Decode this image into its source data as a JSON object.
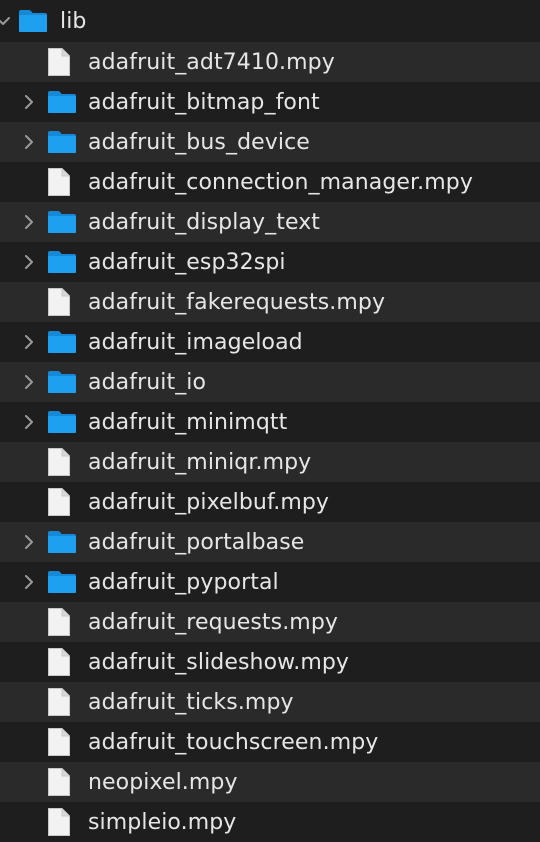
{
  "colors": {
    "row_even": "#1e1e1e",
    "row_odd": "#2a2a2a",
    "text": "#e6e6e6",
    "folder_blue": "#1ea0f0",
    "chevron": "#9a9a9a",
    "file_icon": "#f2f2f2"
  },
  "items": [
    {
      "name": "lib",
      "type": "folder",
      "expanded": true,
      "level": 0
    },
    {
      "name": "adafruit_adt7410.mpy",
      "type": "file",
      "level": 1
    },
    {
      "name": "adafruit_bitmap_font",
      "type": "folder",
      "expanded": false,
      "level": 1
    },
    {
      "name": "adafruit_bus_device",
      "type": "folder",
      "expanded": false,
      "level": 1
    },
    {
      "name": "adafruit_connection_manager.mpy",
      "type": "file",
      "level": 1
    },
    {
      "name": "adafruit_display_text",
      "type": "folder",
      "expanded": false,
      "level": 1
    },
    {
      "name": "adafruit_esp32spi",
      "type": "folder",
      "expanded": false,
      "level": 1
    },
    {
      "name": "adafruit_fakerequests.mpy",
      "type": "file",
      "level": 1
    },
    {
      "name": "adafruit_imageload",
      "type": "folder",
      "expanded": false,
      "level": 1
    },
    {
      "name": "adafruit_io",
      "type": "folder",
      "expanded": false,
      "level": 1
    },
    {
      "name": "adafruit_minimqtt",
      "type": "folder",
      "expanded": false,
      "level": 1
    },
    {
      "name": "adafruit_miniqr.mpy",
      "type": "file",
      "level": 1
    },
    {
      "name": "adafruit_pixelbuf.mpy",
      "type": "file",
      "level": 1
    },
    {
      "name": "adafruit_portalbase",
      "type": "folder",
      "expanded": false,
      "level": 1
    },
    {
      "name": "adafruit_pyportal",
      "type": "folder",
      "expanded": false,
      "level": 1
    },
    {
      "name": "adafruit_requests.mpy",
      "type": "file",
      "level": 1
    },
    {
      "name": "adafruit_slideshow.mpy",
      "type": "file",
      "level": 1
    },
    {
      "name": "adafruit_ticks.mpy",
      "type": "file",
      "level": 1
    },
    {
      "name": "adafruit_touchscreen.mpy",
      "type": "file",
      "level": 1
    },
    {
      "name": "neopixel.mpy",
      "type": "file",
      "level": 1
    },
    {
      "name": "simpleio.mpy",
      "type": "file",
      "level": 1
    }
  ]
}
